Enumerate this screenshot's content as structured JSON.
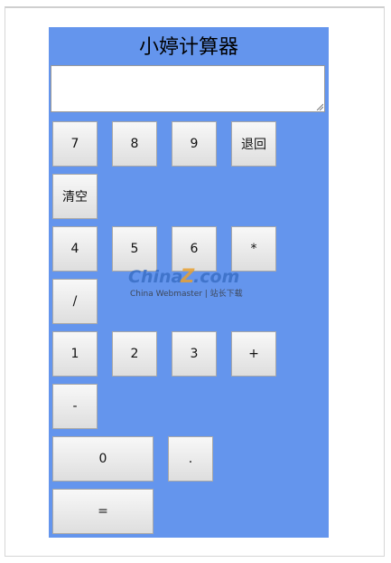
{
  "app": {
    "title": "小婷计算器"
  },
  "display": {
    "value": ""
  },
  "keys": {
    "k7": "7",
    "k8": "8",
    "k9": "9",
    "back": "退回",
    "clear": "清空",
    "k4": "4",
    "k5": "5",
    "k6": "6",
    "mul": "*",
    "div": "/",
    "k1": "1",
    "k2": "2",
    "k3": "3",
    "add": "+",
    "sub": "-",
    "k0": "0",
    "dot": ".",
    "eq": "="
  },
  "watermark": {
    "logo_text": "ChinaZ.com",
    "tagline": "China Webmaster | 站长下载"
  },
  "colors": {
    "panel_bg": "#6495ed",
    "button_top": "#f8f8f8",
    "button_bottom": "#dedede",
    "watermark_blue": "#3a6fc4"
  }
}
